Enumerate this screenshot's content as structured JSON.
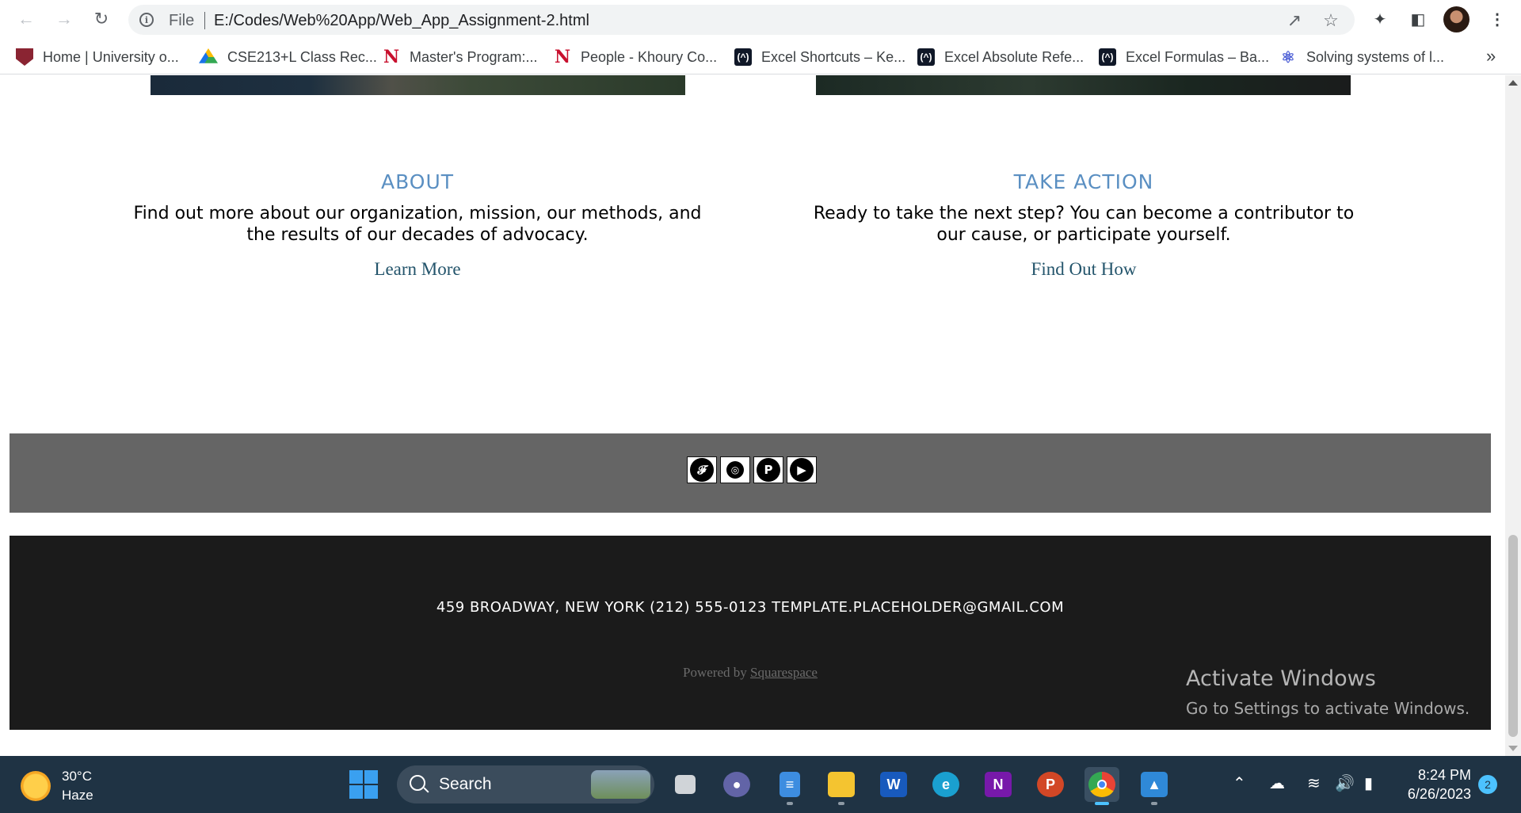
{
  "browser": {
    "back_icon": "arrow-left-icon",
    "forward_icon": "arrow-right-icon",
    "reload_icon": "reload-icon",
    "url_scheme_label": "File",
    "url": "E:/Codes/Web%20App/Web_App_Assignment-2.html",
    "bookmarks": [
      {
        "label": "Home | University o...",
        "icon": "university-shield-icon"
      },
      {
        "label": "CSE213+L Class Rec...",
        "icon": "google-drive-icon"
      },
      {
        "label": "Master's Program:...",
        "icon": "northeastern-n-icon"
      },
      {
        "label": "People - Khoury Co...",
        "icon": "northeastern-n-icon"
      },
      {
        "label": "Excel Shortcuts – Ke...",
        "icon": "excel-site-icon"
      },
      {
        "label": "Excel Absolute Refe...",
        "icon": "excel-site-icon"
      },
      {
        "label": "Excel Formulas – Ba...",
        "icon": "excel-site-icon"
      },
      {
        "label": "Solving systems of l...",
        "icon": "atom-icon"
      }
    ],
    "bookmarks_overflow": "»"
  },
  "content": {
    "about": {
      "title": "ABOUT",
      "text": "Find out more about our organization, mission, our methods, and the results of our decades of advocacy.",
      "link": "Learn More"
    },
    "take_action": {
      "title": "TAKE ACTION",
      "text": "Ready to take the next step? You can become a contributor to our cause, or participate yourself.",
      "link": "Find Out How"
    },
    "social": [
      "twitter-icon",
      "instagram-icon",
      "pinterest-icon",
      "youtube-icon"
    ],
    "footer": {
      "contact": "459 BROADWAY, NEW YORK (212) 555-0123 TEMPLATE.PLACEHOLDER@GMAIL.COM",
      "powered_prefix": "Powered by",
      "powered_link": "Squarespace"
    }
  },
  "watermark": {
    "title": "Activate Windows",
    "subtitle": "Go to Settings to activate Windows."
  },
  "taskbar": {
    "weather_temp": "30°C",
    "weather_desc": "Haze",
    "search_label": "Search",
    "apps": [
      "task-view-icon",
      "teams-icon",
      "notepad-icon",
      "file-explorer-icon",
      "word-icon",
      "edge-icon",
      "onenote-icon",
      "powerpoint-icon",
      "chrome-icon",
      "photos-icon"
    ],
    "time": "8:24 PM",
    "date": "6/26/2023",
    "notification_count": "2"
  }
}
